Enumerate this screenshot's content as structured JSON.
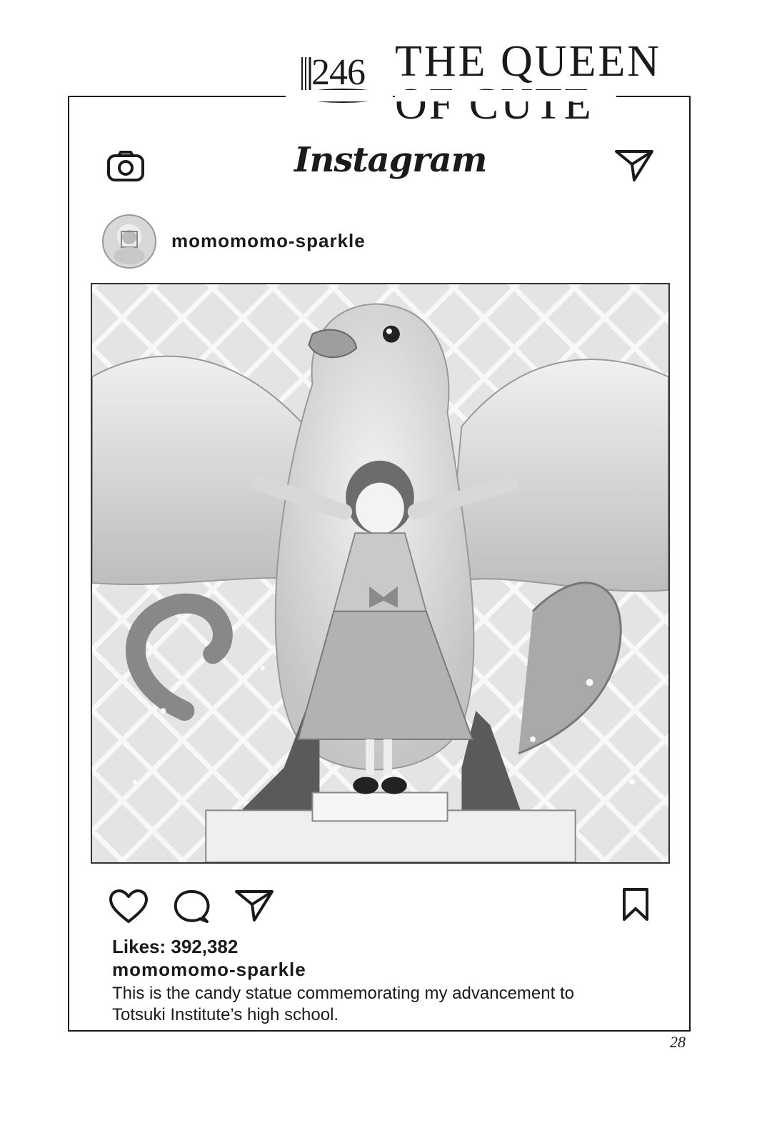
{
  "chapter": {
    "number": "246",
    "title_line1": "THE QUEEN",
    "title_line2": "OF CUTE"
  },
  "app": {
    "brand": "Instagram",
    "icons": {
      "camera": "camera-icon",
      "direct": "paper-plane-icon",
      "like": "heart-icon",
      "comment": "comment-bubble-icon",
      "share": "send-icon",
      "save": "bookmark-icon"
    }
  },
  "post": {
    "username": "momomomo-sparkle",
    "image_alt": "candy statue of a giant bird with a girl standing in front",
    "likes": "Likes: 392,382",
    "caption_user": "momomomo-sparkle",
    "caption": "This is the candy statue commemorating my advancement to Totsuki Institute’s high school."
  },
  "page": {
    "number": "28"
  }
}
